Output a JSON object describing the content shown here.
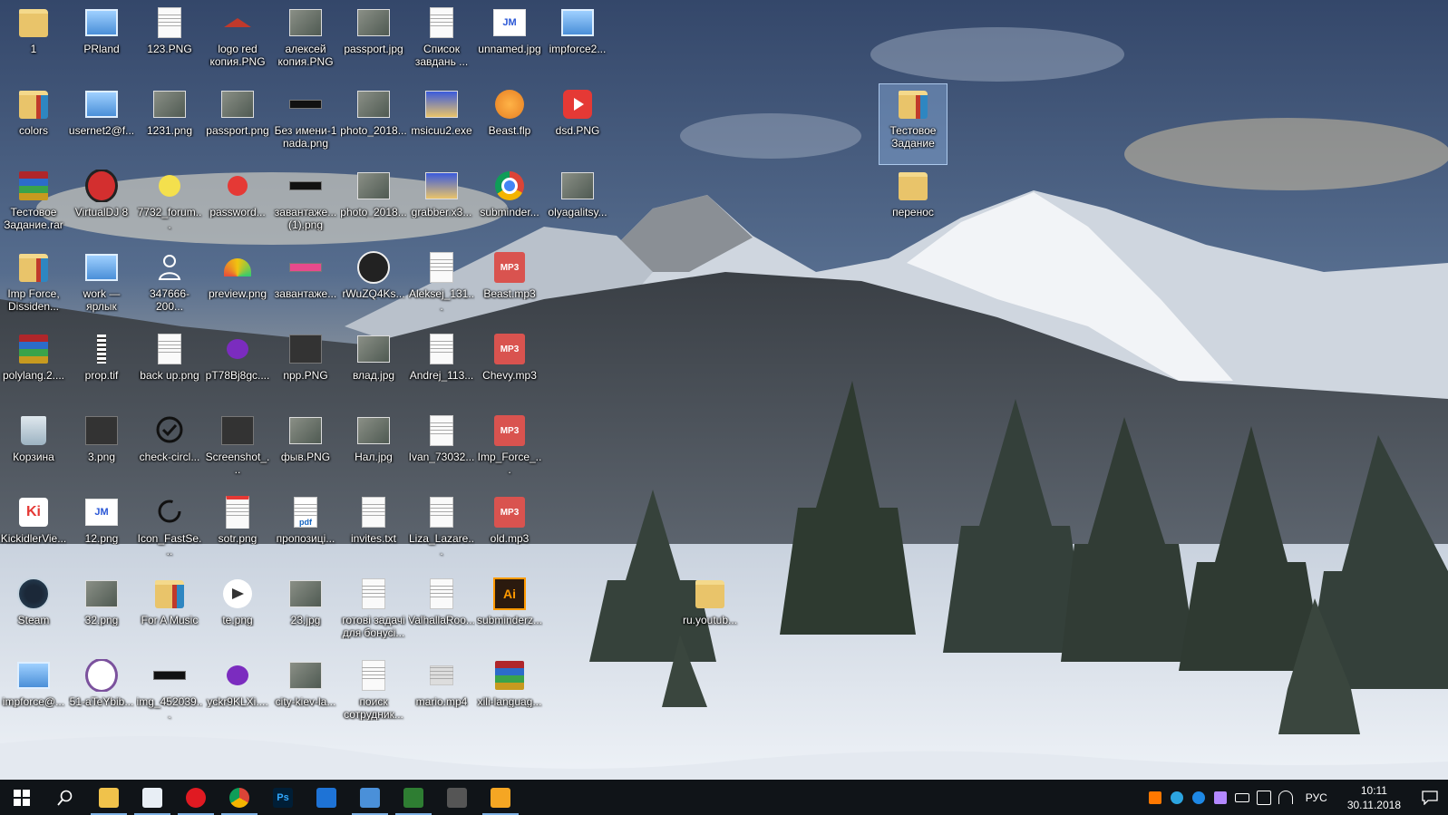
{
  "desktop_icons": [
    {
      "label": "1",
      "type": "folder-picture",
      "col": 0,
      "row": 0
    },
    {
      "label": "PRland",
      "type": "network",
      "col": 1,
      "row": 0
    },
    {
      "label": "123.PNG",
      "type": "blank",
      "col": 2,
      "row": 0
    },
    {
      "label": "logo red копия.PNG",
      "type": "logo-red",
      "col": 3,
      "row": 0
    },
    {
      "label": "алексей копия.PNG",
      "type": "image",
      "col": 4,
      "row": 0
    },
    {
      "label": "passport.jpg",
      "type": "image",
      "col": 5,
      "row": 0
    },
    {
      "label": "Список завдань ...",
      "type": "document",
      "col": 6,
      "row": 0
    },
    {
      "label": "unnamed.jpg",
      "type": "image-jm",
      "col": 7,
      "row": 0
    },
    {
      "label": "impforce2...",
      "type": "network",
      "col": 8,
      "row": 0
    },
    {
      "label": "colors",
      "type": "folder-book",
      "col": 0,
      "row": 1
    },
    {
      "label": "usernet2@f...",
      "type": "network",
      "col": 1,
      "row": 1
    },
    {
      "label": "1231.png",
      "type": "image",
      "col": 2,
      "row": 1
    },
    {
      "label": "passport.png",
      "type": "image",
      "col": 3,
      "row": 1
    },
    {
      "label": "Без имени-1 nada.png",
      "type": "dark-strip",
      "col": 4,
      "row": 1
    },
    {
      "label": "photo_2018...",
      "type": "image",
      "col": 5,
      "row": 1
    },
    {
      "label": "msicuu2.exe",
      "type": "exe",
      "col": 6,
      "row": 1
    },
    {
      "label": "Beast.flp",
      "type": "fl-studio",
      "col": 7,
      "row": 1
    },
    {
      "label": "dsd.PNG",
      "type": "youtube",
      "col": 8,
      "row": 1
    },
    {
      "label": "Тестовое Задание.rar",
      "type": "rar",
      "col": 0,
      "row": 2
    },
    {
      "label": "VirtualDJ 8",
      "type": "virtualdj",
      "col": 1,
      "row": 2
    },
    {
      "label": "7732_forum...",
      "type": "yellow-circle",
      "col": 2,
      "row": 2
    },
    {
      "label": "password...",
      "type": "red-circle",
      "col": 3,
      "row": 2
    },
    {
      "label": "завантаже... (1).png",
      "type": "dark-strip",
      "col": 4,
      "row": 2
    },
    {
      "label": "photo_2018...",
      "type": "image",
      "col": 5,
      "row": 2
    },
    {
      "label": "grabber.x3...",
      "type": "exe",
      "col": 6,
      "row": 2
    },
    {
      "label": "subminder...",
      "type": "chrome",
      "col": 7,
      "row": 2
    },
    {
      "label": "olyagalitsy...",
      "type": "image",
      "col": 8,
      "row": 2
    },
    {
      "label": "Imp Force, Dissiden...",
      "type": "folder-book",
      "col": 0,
      "row": 3
    },
    {
      "label": "work — ярлык",
      "type": "network",
      "col": 1,
      "row": 3
    },
    {
      "label": "347666-200...",
      "type": "person",
      "col": 2,
      "row": 3
    },
    {
      "label": "preview.png",
      "type": "rainbow",
      "col": 3,
      "row": 3
    },
    {
      "label": "завантаже...",
      "type": "pink-strip",
      "col": 4,
      "row": 3
    },
    {
      "label": "rWuZQ4Ks...",
      "type": "round-logo",
      "col": 5,
      "row": 3
    },
    {
      "label": "Aleksej_131...",
      "type": "document",
      "col": 6,
      "row": 3
    },
    {
      "label": "Beast.mp3",
      "type": "mp3",
      "col": 7,
      "row": 3
    },
    {
      "label": "polylang.2....",
      "type": "rar",
      "col": 0,
      "row": 4
    },
    {
      "label": "prop.tif",
      "type": "tif",
      "col": 1,
      "row": 4
    },
    {
      "label": "back up.png",
      "type": "blank",
      "col": 2,
      "row": 4
    },
    {
      "label": "pT78Bj8gc....",
      "type": "purple",
      "col": 3,
      "row": 4
    },
    {
      "label": "npp.PNG",
      "type": "dark-tile",
      "col": 4,
      "row": 4
    },
    {
      "label": "влад.jpg",
      "type": "image",
      "col": 5,
      "row": 4
    },
    {
      "label": "Andrej_113...",
      "type": "document",
      "col": 6,
      "row": 4
    },
    {
      "label": "Chevy.mp3",
      "type": "mp3",
      "col": 7,
      "row": 4
    },
    {
      "label": "Корзина",
      "type": "recycle",
      "col": 0,
      "row": 5
    },
    {
      "label": "3.png",
      "type": "dark-tile",
      "col": 1,
      "row": 5
    },
    {
      "label": "check-circl...",
      "type": "check",
      "col": 2,
      "row": 5
    },
    {
      "label": "Screenshot_...",
      "type": "dark-tile",
      "col": 3,
      "row": 5
    },
    {
      "label": "фыв.PNG",
      "type": "image",
      "col": 4,
      "row": 5
    },
    {
      "label": "Нал.jpg",
      "type": "image",
      "col": 5,
      "row": 5
    },
    {
      "label": "Ivan_73032...",
      "type": "document",
      "col": 6,
      "row": 5
    },
    {
      "label": "Imp_Force_...",
      "type": "mp3",
      "col": 7,
      "row": 5
    },
    {
      "label": "KickidlerVie...",
      "type": "ki",
      "col": 0,
      "row": 6
    },
    {
      "label": "12.png",
      "type": "image-jm",
      "col": 1,
      "row": 6
    },
    {
      "label": "Icon_FastSe...",
      "type": "fast",
      "col": 2,
      "row": 6
    },
    {
      "label": "sotr.png",
      "type": "calendar",
      "col": 3,
      "row": 6
    },
    {
      "label": "пропозиці...",
      "type": "pdf",
      "col": 4,
      "row": 6
    },
    {
      "label": "invites.txt",
      "type": "document",
      "col": 5,
      "row": 6
    },
    {
      "label": "Liza_Lazare...",
      "type": "document",
      "col": 6,
      "row": 6
    },
    {
      "label": "old.mp3",
      "type": "mp3",
      "col": 7,
      "row": 6
    },
    {
      "label": "Steam",
      "type": "steam",
      "col": 0,
      "row": 7
    },
    {
      "label": "32.png",
      "type": "image",
      "col": 1,
      "row": 7
    },
    {
      "label": "For A Music",
      "type": "folder-book",
      "col": 2,
      "row": 7
    },
    {
      "label": "te.png",
      "type": "telegram-white",
      "col": 3,
      "row": 7
    },
    {
      "label": "23.jpg",
      "type": "image",
      "col": 4,
      "row": 7
    },
    {
      "label": "готові задачі для бонусі...",
      "type": "document",
      "col": 5,
      "row": 7
    },
    {
      "label": "ValhallaRoo...",
      "type": "blank",
      "col": 6,
      "row": 7
    },
    {
      "label": "subminderz...",
      "type": "illustrator",
      "col": 7,
      "row": 7
    },
    {
      "label": "ru.youtub...",
      "type": "folder",
      "col": 10,
      "row": 7
    },
    {
      "label": "impforce@...",
      "type": "network",
      "col": 0,
      "row": 8
    },
    {
      "label": "51-aTeYbib...",
      "type": "viber",
      "col": 1,
      "row": 8
    },
    {
      "label": "img_452039...",
      "type": "dark-strip",
      "col": 2,
      "row": 8
    },
    {
      "label": "yckr9KLXi....",
      "type": "purple",
      "col": 3,
      "row": 8
    },
    {
      "label": "city-kiev-la...",
      "type": "image",
      "col": 4,
      "row": 8
    },
    {
      "label": "поиск сотрудник...",
      "type": "document",
      "col": 5,
      "row": 8
    },
    {
      "label": "mario.mp4",
      "type": "video",
      "col": 6,
      "row": 8
    },
    {
      "label": "xili-languag...",
      "type": "rar",
      "col": 7,
      "row": 8
    },
    {
      "label": "Тестовое Задание",
      "type": "folder-book",
      "col": 13,
      "row": 1,
      "selected": true
    },
    {
      "label": "перенос",
      "type": "folder",
      "col": 13,
      "row": 2
    }
  ],
  "taskbar": {
    "pinned": [
      {
        "name": "start-button",
        "icon": "windows-icon",
        "active": false
      },
      {
        "name": "search-button",
        "icon": "search-icon",
        "active": false
      },
      {
        "name": "file-explorer",
        "icon": "folder-icon",
        "active": true
      },
      {
        "name": "paint-app",
        "icon": "paint-icon",
        "active": true
      },
      {
        "name": "opera-browser",
        "icon": "opera-icon",
        "active": true
      },
      {
        "name": "chrome-browser",
        "icon": "chrome-icon",
        "active": true
      },
      {
        "name": "photoshop",
        "icon": "photoshop-icon",
        "active": false,
        "text": "Ps"
      },
      {
        "name": "edge-browser",
        "icon": "edge-icon",
        "active": false
      },
      {
        "name": "image-viewer",
        "icon": "image-icon",
        "active": true
      },
      {
        "name": "spreadsheet-app",
        "icon": "chart-icon",
        "active": true
      },
      {
        "name": "keyboard-app",
        "icon": "keyboard-icon",
        "active": false
      },
      {
        "name": "media-player",
        "icon": "media-icon",
        "active": true
      }
    ],
    "tray": {
      "icons": [
        "avast-icon",
        "telegram-icon",
        "bluetooth-icon",
        "pen-icon",
        "battery-icon",
        "volume-icon",
        "wifi-icon"
      ],
      "language": "РУС",
      "time": "10:11",
      "date": "30.11.2018"
    }
  }
}
